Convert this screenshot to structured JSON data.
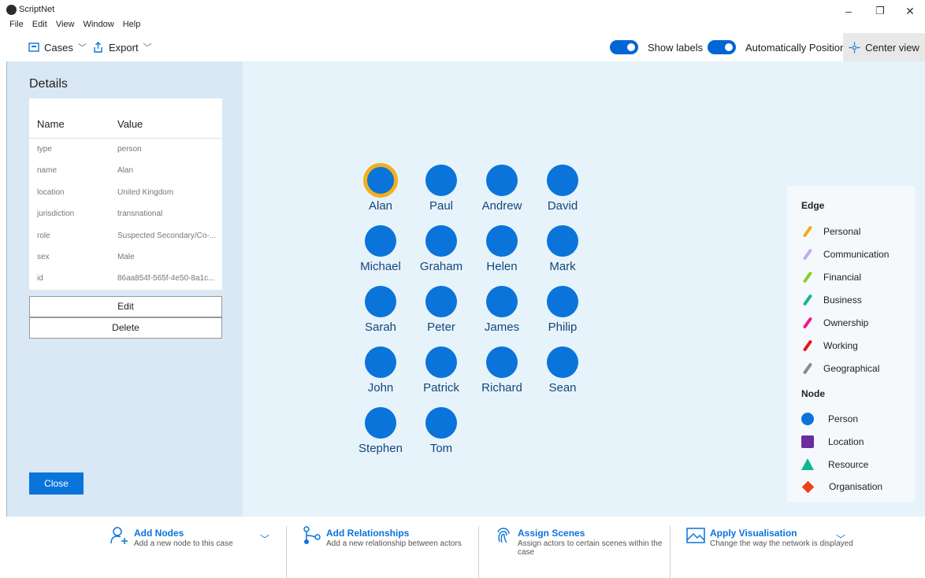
{
  "app": {
    "title": "ScriptNet"
  },
  "window_controls": {
    "minimize": "–",
    "restore": "❐",
    "close": "✕"
  },
  "menu": [
    "File",
    "Edit",
    "View",
    "Window",
    "Help"
  ],
  "toolbar": {
    "cases_label": "Cases",
    "export_label": "Export",
    "show_labels": {
      "label": "Show labels",
      "on": true
    },
    "auto_position": {
      "label": "Automatically Position",
      "on": true
    },
    "center_view_label": "Center view"
  },
  "details": {
    "title": "Details",
    "columns": [
      "Name",
      "Value"
    ],
    "rows": [
      {
        "name": "type",
        "value": "person"
      },
      {
        "name": "name",
        "value": "Alan"
      },
      {
        "name": "location",
        "value": "United Kingdom"
      },
      {
        "name": "jurisdiction",
        "value": "transnational"
      },
      {
        "name": "role",
        "value": "Suspected Secondary/Co-..."
      },
      {
        "name": "sex",
        "value": "Male"
      },
      {
        "name": "id",
        "value": "86aa854f-565f-4e50-8a1c..."
      }
    ],
    "edit_label": "Edit",
    "delete_label": "Delete",
    "close_label": "Close"
  },
  "graph": {
    "selected": "Alan",
    "nodes": [
      "Alan",
      "Paul",
      "Andrew",
      "David",
      "Michael",
      "Graham",
      "Helen",
      "Mark",
      "Sarah",
      "Peter",
      "James",
      "Philip",
      "John",
      "Patrick",
      "Richard",
      "Sean",
      "Stephen",
      "Tom"
    ]
  },
  "legend": {
    "edge_title": "Edge",
    "edges": [
      {
        "label": "Personal",
        "color": "#f7a81b"
      },
      {
        "label": "Communication",
        "color": "#c4a6f0"
      },
      {
        "label": "Financial",
        "color": "#8cd11f"
      },
      {
        "label": "Business",
        "color": "#12b592"
      },
      {
        "label": "Ownership",
        "color": "#f2188e"
      },
      {
        "label": "Working",
        "color": "#e8141e"
      },
      {
        "label": "Geographical",
        "color": "#8a8a8a"
      }
    ],
    "node_title": "Node",
    "nodes": [
      {
        "label": "Person",
        "color": "#0a74da",
        "shape": "circle"
      },
      {
        "label": "Location",
        "color": "#6b2c9e",
        "shape": "square"
      },
      {
        "label": "Resource",
        "color": "#12b592",
        "shape": "triangle"
      },
      {
        "label": "Organisation",
        "color": "#f0401a",
        "shape": "diamond"
      }
    ]
  },
  "commands": [
    {
      "title": "Add Nodes",
      "desc": "Add a new node to this case",
      "icon": "add-person-icon"
    },
    {
      "title": "Add Relationships",
      "desc": "Add a new relationship between actors",
      "icon": "relationship-icon"
    },
    {
      "title": "Assign Scenes",
      "desc": "Assign actors to certain scenes within the case",
      "icon": "fingerprint-icon"
    },
    {
      "title": "Apply Visualisation",
      "desc": "Change the way the network is displayed",
      "icon": "picture-icon"
    }
  ]
}
